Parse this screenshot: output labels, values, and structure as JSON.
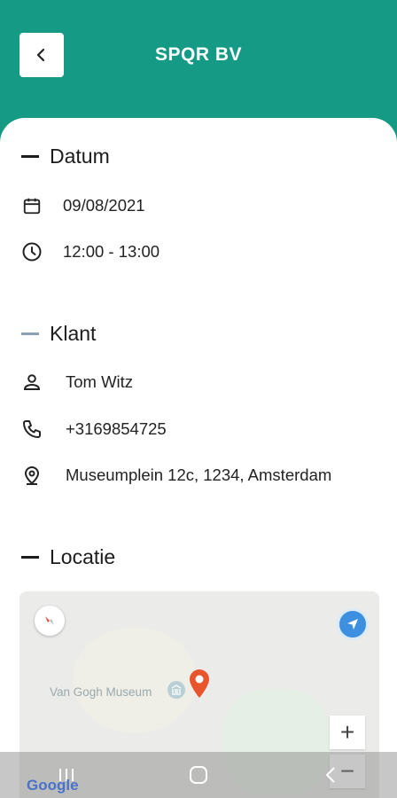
{
  "header": {
    "title": "SPQR BV",
    "back_icon": "chevron-left-icon"
  },
  "sections": {
    "datum": {
      "title": "Datum",
      "date": "09/08/2021",
      "time": "12:00 - 13:00"
    },
    "klant": {
      "title": "Klant",
      "name": "Tom Witz",
      "phone": "+3169854725",
      "address": "Museumplein 12c, 1234, Amsterdam"
    },
    "locatie": {
      "title": "Locatie",
      "map": {
        "poi_label": "Van Gogh Museum",
        "zoom_in": "+",
        "zoom_out": "−",
        "attribution": "Google"
      }
    }
  },
  "colors": {
    "primary": "#159a85",
    "pin": "#e8542b",
    "locate": "#3d8fe0"
  }
}
